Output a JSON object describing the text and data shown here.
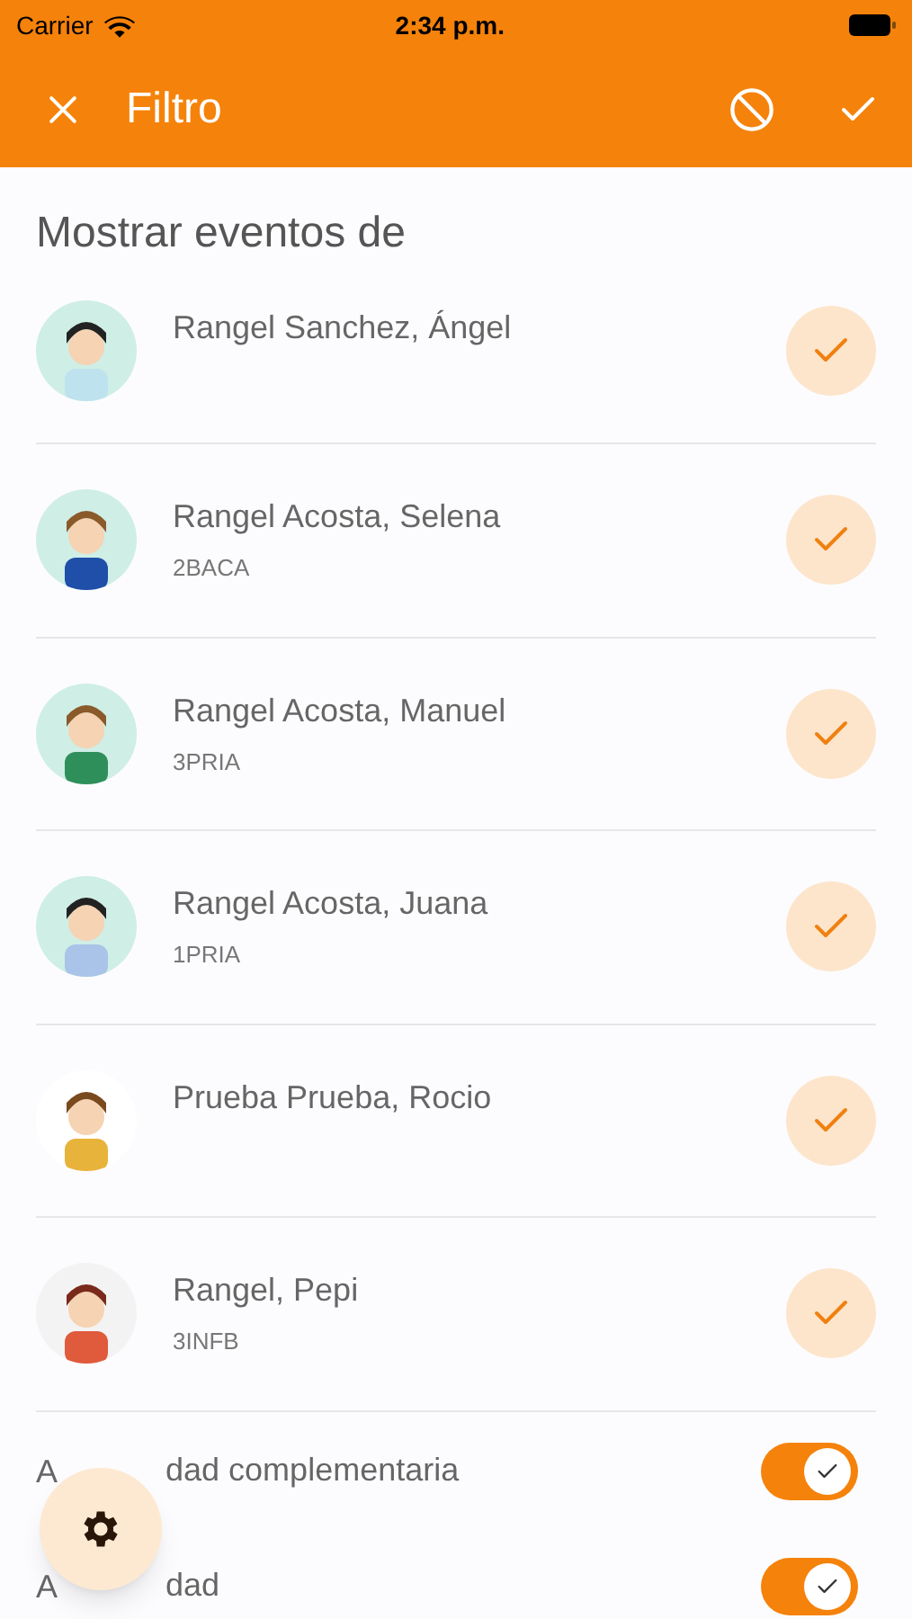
{
  "status_bar": {
    "carrier": "Carrier",
    "time": "2:34 p.m."
  },
  "header": {
    "title": "Filtro"
  },
  "section_title": "Mostrar eventos de",
  "people": [
    {
      "name": "Rangel Sanchez, Ángel",
      "selected": true,
      "color": "#cfeee6"
    },
    {
      "name": "Rangel Acosta, Selena",
      "group": "2BACA",
      "selected": true,
      "color": "#cfeee6"
    },
    {
      "name": "Rangel Acosta, Manuel",
      "group": "3PRIA",
      "selected": true,
      "color": "#cfeee6"
    },
    {
      "name": "Rangel Acosta, Juana",
      "group": "1PRIA",
      "selected": true,
      "color": "#cfeee6"
    },
    {
      "name": "Prueba Prueba, Rocio",
      "selected": true,
      "color": "#ffffff"
    },
    {
      "name": "Rangel, Pepi",
      "group": "3INFB",
      "selected": true,
      "color": "#f3f3f3"
    }
  ],
  "toggles": [
    {
      "label_parts": [
        "A",
        "dad complementaria"
      ],
      "on": true
    },
    {
      "label_parts": [
        "A",
        "dad"
      ],
      "on": true
    }
  ]
}
